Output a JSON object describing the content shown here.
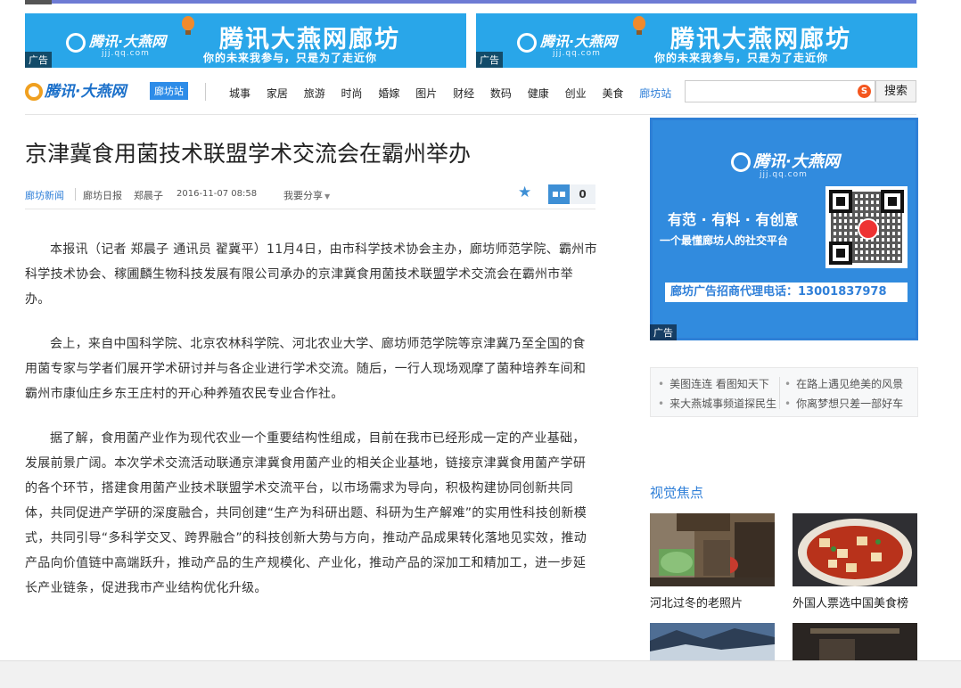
{
  "top_ads": [
    {
      "logo": "腾讯·大燕网",
      "url": "jjj.qq.com",
      "title": "腾讯大燕网廊坊",
      "slogan": "你的未来我参与，只是为了走近你",
      "tag": "广告"
    },
    {
      "logo": "腾讯·大燕网",
      "url": "jjj.qq.com",
      "title": "腾讯大燕网廊坊",
      "slogan": "你的未来我参与，只是为了走近你",
      "tag": "广告"
    }
  ],
  "nav": {
    "brand": "腾讯·大燕网",
    "city": "廊坊站",
    "items": [
      "城事",
      "家居",
      "旅游",
      "时尚",
      "婚嫁",
      "图片",
      "财经",
      "数码",
      "健康",
      "创业",
      "美食",
      "廊坊站"
    ],
    "search_placeholder": "",
    "search_button": "搜索"
  },
  "article": {
    "title": "京津冀食用菌技术联盟学术交流会在霸州举办",
    "channel": "廊坊新闻",
    "source": "廊坊日报",
    "author": "郑晨子",
    "time": "2016-11-07 08:58",
    "share": "我要分享",
    "comment_count": "0",
    "paragraphs": [
      "本报讯（记者 郑晨子 通讯员 翟冀平）11月4日，由市科学技术协会主办，廊坊师范学院、霸州市科学技术协会、稼圃麟生物科技发展有限公司承办的京津冀食用菌技术联盟学术交流会在霸州市举办。",
      "会上，来自中国科学院、北京农林科学院、河北农业大学、廊坊师范学院等京津冀乃至全国的食用菌专家与学者们展开学术研讨并与各企业进行学术交流。随后，一行人现场观摩了菌种培养车间和霸州市康仙庄乡东王庄村的开心种养殖农民专业合作社。",
      "据了解，食用菌产业作为现代农业一个重要结构性组成，目前在我市已经形成一定的产业基础，发展前景广阔。本次学术交流活动联通京津冀食用菌产业的相关企业基地，链接京津冀食用菌产学研的各个环节，搭建食用菌产业技术联盟学术交流平台，以市场需求为导向，积极构建协同创新共同体，共同促进产学研的深度融合，共同创建“生产为科研出题、科研为生产解难”的实用性科技创新模式，共同引导“多科学交叉、跨界融合”的科技创新大势与方向，推动产品成果转化落地见实效，推动产品向价值链中高端跃升，推动产品的生产规模化、产业化，推动产品的深加工和精加工，进一步延长产业链条，促进我市产业结构优化升级。"
    ]
  },
  "side_ad": {
    "logo": "腾讯·大燕网",
    "url": "jjj.qq.com",
    "line1": "有范 · 有料 · 有创意",
    "line2": "一个最懂廊坊人的社交平台",
    "band": "廊坊广告招商代理电话：13001837978",
    "tag": "广告"
  },
  "side_links": {
    "col1": [
      "美图连连  看图知天下",
      "来大燕城事频道探民生"
    ],
    "col2": [
      "在路上遇见绝美的风景",
      "你离梦想只差一部好车"
    ]
  },
  "focus": {
    "title": "视觉焦点",
    "items": [
      {
        "caption": "河北过冬的老照片"
      },
      {
        "caption": "外国人票选中国美食榜"
      }
    ]
  },
  "colors": {
    "accent": "#2f7fd8",
    "ad_blue": "#29a6e9",
    "nav_bar": "#6e7bd4"
  }
}
